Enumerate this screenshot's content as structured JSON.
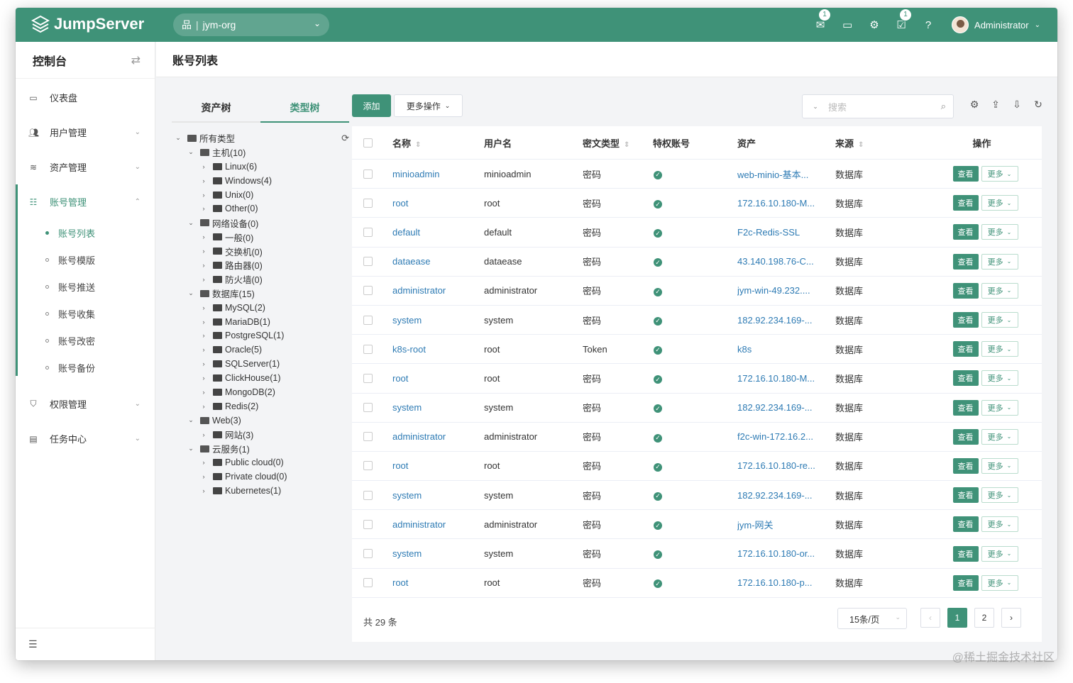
{
  "app": {
    "name": "JumpServer",
    "org": "jym-org"
  },
  "topbar": {
    "badges": {
      "messages": "1",
      "tasks": "1"
    },
    "user": "Administrator"
  },
  "sidebar": {
    "title": "控制台",
    "items": [
      {
        "label": "仪表盘",
        "icon": "dashboard-icon"
      },
      {
        "label": "用户管理",
        "icon": "users-icon"
      },
      {
        "label": "资产管理",
        "icon": "assets-icon"
      },
      {
        "label": "账号管理",
        "icon": "accounts-icon"
      },
      {
        "label": "权限管理",
        "icon": "shield-icon"
      },
      {
        "label": "任务中心",
        "icon": "calendar-icon"
      }
    ],
    "subitems": [
      "账号列表",
      "账号模版",
      "账号推送",
      "账号收集",
      "账号改密",
      "账号备份"
    ],
    "active_sub": "账号列表"
  },
  "page_title": "账号列表",
  "tree": {
    "tabs": [
      "资产树",
      "类型树"
    ],
    "active_tab": "类型树",
    "nodes": [
      {
        "label": "所有类型",
        "level": 0,
        "open": true
      },
      {
        "label": "主机(10)",
        "level": 1,
        "open": true
      },
      {
        "label": "Linux(6)",
        "level": 2,
        "open": false
      },
      {
        "label": "Windows(4)",
        "level": 2,
        "open": false
      },
      {
        "label": "Unix(0)",
        "level": 2,
        "open": false
      },
      {
        "label": "Other(0)",
        "level": 2,
        "open": false
      },
      {
        "label": "网络设备(0)",
        "level": 1,
        "open": true
      },
      {
        "label": "一般(0)",
        "level": 2,
        "open": false
      },
      {
        "label": "交换机(0)",
        "level": 2,
        "open": false
      },
      {
        "label": "路由器(0)",
        "level": 2,
        "open": false
      },
      {
        "label": "防火墙(0)",
        "level": 2,
        "open": false
      },
      {
        "label": "数据库(15)",
        "level": 1,
        "open": true
      },
      {
        "label": "MySQL(2)",
        "level": 2,
        "open": false
      },
      {
        "label": "MariaDB(1)",
        "level": 2,
        "open": false
      },
      {
        "label": "PostgreSQL(1)",
        "level": 2,
        "open": false
      },
      {
        "label": "Oracle(5)",
        "level": 2,
        "open": false
      },
      {
        "label": "SQLServer(1)",
        "level": 2,
        "open": false
      },
      {
        "label": "ClickHouse(1)",
        "level": 2,
        "open": false
      },
      {
        "label": "MongoDB(2)",
        "level": 2,
        "open": false
      },
      {
        "label": "Redis(2)",
        "level": 2,
        "open": false
      },
      {
        "label": "Web(3)",
        "level": 1,
        "open": true
      },
      {
        "label": "网站(3)",
        "level": 2,
        "open": false
      },
      {
        "label": "云服务(1)",
        "level": 1,
        "open": true
      },
      {
        "label": "Public cloud(0)",
        "level": 2,
        "open": false
      },
      {
        "label": "Private cloud(0)",
        "level": 2,
        "open": false
      },
      {
        "label": "Kubernetes(1)",
        "level": 2,
        "open": false
      }
    ]
  },
  "toolbar": {
    "add": "添加",
    "more_ops": "更多操作",
    "search_placeholder": "搜索"
  },
  "table": {
    "headers": {
      "name": "名称",
      "username": "用户名",
      "secret_type": "密文类型",
      "privileged": "特权账号",
      "asset": "资产",
      "source": "来源",
      "actions": "操作"
    },
    "view_label": "查看",
    "more_label": "更多",
    "rows": [
      {
        "name": "minioadmin",
        "username": "minioadmin",
        "secret_type": "密码",
        "asset": "web-minio-基本...",
        "source": "数据库"
      },
      {
        "name": "root",
        "username": "root",
        "secret_type": "密码",
        "asset": "172.16.10.180-M...",
        "source": "数据库"
      },
      {
        "name": "default",
        "username": "default",
        "secret_type": "密码",
        "asset": "F2c-Redis-SSL",
        "source": "数据库"
      },
      {
        "name": "dataease",
        "username": "dataease",
        "secret_type": "密码",
        "asset": "43.140.198.76-C...",
        "source": "数据库"
      },
      {
        "name": "administrator",
        "username": "administrator",
        "secret_type": "密码",
        "asset": "jym-win-49.232....",
        "source": "数据库"
      },
      {
        "name": "system",
        "username": "system",
        "secret_type": "密码",
        "asset": "182.92.234.169-...",
        "source": "数据库"
      },
      {
        "name": "k8s-root",
        "username": "root",
        "secret_type": "Token",
        "asset": "k8s",
        "source": "数据库"
      },
      {
        "name": "root",
        "username": "root",
        "secret_type": "密码",
        "asset": "172.16.10.180-M...",
        "source": "数据库"
      },
      {
        "name": "system",
        "username": "system",
        "secret_type": "密码",
        "asset": "182.92.234.169-...",
        "source": "数据库"
      },
      {
        "name": "administrator",
        "username": "administrator",
        "secret_type": "密码",
        "asset": "f2c-win-172.16.2...",
        "source": "数据库"
      },
      {
        "name": "root",
        "username": "root",
        "secret_type": "密码",
        "asset": "172.16.10.180-re...",
        "source": "数据库"
      },
      {
        "name": "system",
        "username": "system",
        "secret_type": "密码",
        "asset": "182.92.234.169-...",
        "source": "数据库"
      },
      {
        "name": "administrator",
        "username": "administrator",
        "secret_type": "密码",
        "asset": "jym-网关",
        "source": "数据库"
      },
      {
        "name": "system",
        "username": "system",
        "secret_type": "密码",
        "asset": "172.16.10.180-or...",
        "source": "数据库"
      },
      {
        "name": "root",
        "username": "root",
        "secret_type": "密码",
        "asset": "172.16.10.180-p...",
        "source": "数据库"
      }
    ]
  },
  "pagination": {
    "total": "共 29 条",
    "page_size": "15条/页",
    "pages": [
      "1",
      "2"
    ],
    "current": "1"
  },
  "watermark": "@稀土掘金技术社区",
  "colors": {
    "primary": "#3f9278",
    "link": "#2e7bb4"
  }
}
